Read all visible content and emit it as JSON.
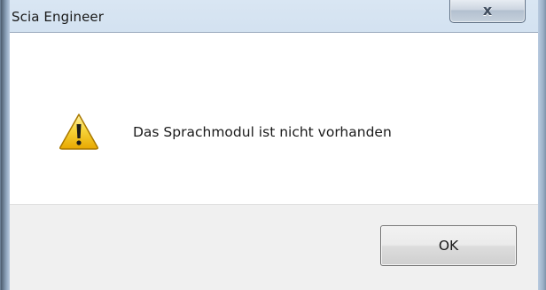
{
  "dialog": {
    "title": "Scia Engineer",
    "close_label": "x",
    "message": "Das Sprachmodul ist nicht vorhanden",
    "icon": "warning-triangle",
    "ok_label": "OK"
  },
  "colors": {
    "warning_fill": "#f5c518",
    "warning_stroke": "#b07d00",
    "content_bg": "#ffffff",
    "footer_bg": "#f0f0f0"
  }
}
